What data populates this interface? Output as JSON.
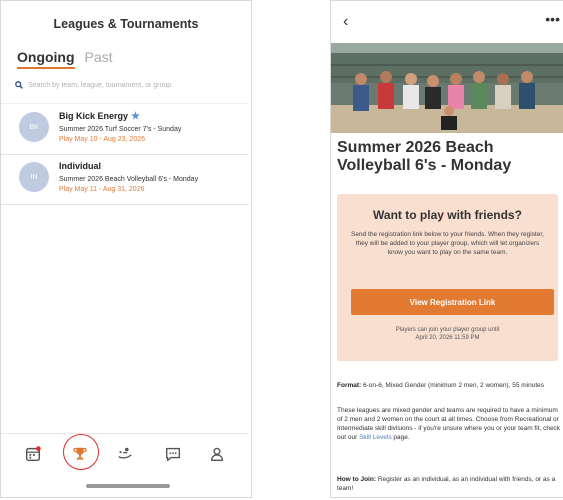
{
  "left": {
    "title": "Leagues & Tournaments",
    "tabs": [
      "Ongoing",
      "Past"
    ],
    "search_placeholder": "Search by team, league, tournament, or group",
    "cards": [
      {
        "initials": "BK",
        "name": "Big Kick Energy",
        "starred": true,
        "league": "Summer 2026 Turf Soccer 7's - Sunday",
        "dates": "Play May 10 - Aug 23, 2026"
      },
      {
        "initials": "IN",
        "name": "Individual",
        "starred": false,
        "league": "Summer 2026 Beach Volleyball 6's - Monday",
        "dates": "Play May 11 - Aug 31, 2026"
      }
    ],
    "nav_icons": [
      "calendar-icon",
      "trophy-icon",
      "players-icon",
      "chat-icon",
      "profile-icon"
    ],
    "active_nav": "trophy-icon"
  },
  "right": {
    "back": "‹",
    "more": "•••",
    "event_title": "Summer 2026 Beach Volleyball 6's - Monday",
    "promo": {
      "heading": "Want to play with friends?",
      "body": "Send the registration link below to your friends. When they register, they will be added to your player group, which will let organizers know you want to play on the same team.",
      "button": "View Registration Link",
      "note_line1": "Players can join your player group until",
      "note_line2": "April 20, 2026 11:59 PM"
    },
    "format_label": "Format:",
    "format_text": "6-on-6, Mixed Gender (minimum 2 men, 2 women), 55 minutes",
    "desc_text": "These leagues are mixed gender and teams are required to have a minimum of 2 men and 2 women on the court at all times. Choose from Recreational or Intermediate skill divisions - if you're unsure where you or your team fit, check out our",
    "desc_link": "Skill Levels",
    "desc_end": "page.",
    "join_label": "How to Join:",
    "join_text": "Register as an individual, as an individual with friends, or as a team!"
  },
  "colors": {
    "accent": "#e37a31",
    "promo_bg": "#f8dfcf",
    "avatar": "#bfcbe0",
    "star": "#5b8fd6",
    "ring": "#e02b2b"
  }
}
